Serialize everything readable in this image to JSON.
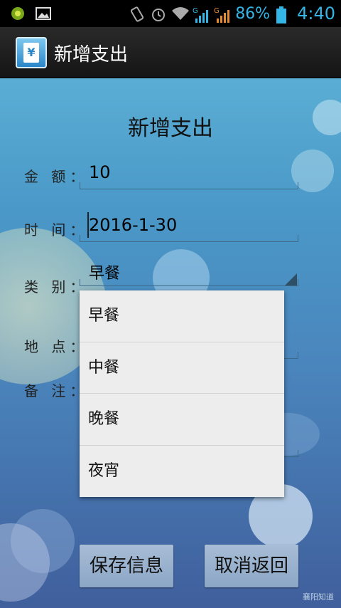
{
  "status_bar": {
    "icons_left": [
      "notification-icon",
      "image-icon"
    ],
    "icons_right": [
      "vibrate-icon",
      "alarm-icon",
      "wifi-icon",
      "signal-g-icon",
      "signal-g-icon"
    ],
    "battery": "86%",
    "time": "4:40",
    "accent_color": "#33b5e5"
  },
  "action_bar": {
    "title": "新增支出",
    "app_icon_glyph": "¥"
  },
  "form": {
    "heading": "新增支出",
    "amount": {
      "label": "金 额：",
      "value": "10"
    },
    "time": {
      "label": "时 间：",
      "value": "2016-1-30"
    },
    "category": {
      "label": "类 别：",
      "value": "早餐"
    },
    "location": {
      "label": "地 点："
    },
    "note": {
      "label": "备 注："
    }
  },
  "dropdown": {
    "options": [
      "早餐",
      "中餐",
      "晚餐",
      "夜宵"
    ]
  },
  "buttons": {
    "save": "保存信息",
    "cancel": "取消返回"
  },
  "watermark": "襄阳知道"
}
